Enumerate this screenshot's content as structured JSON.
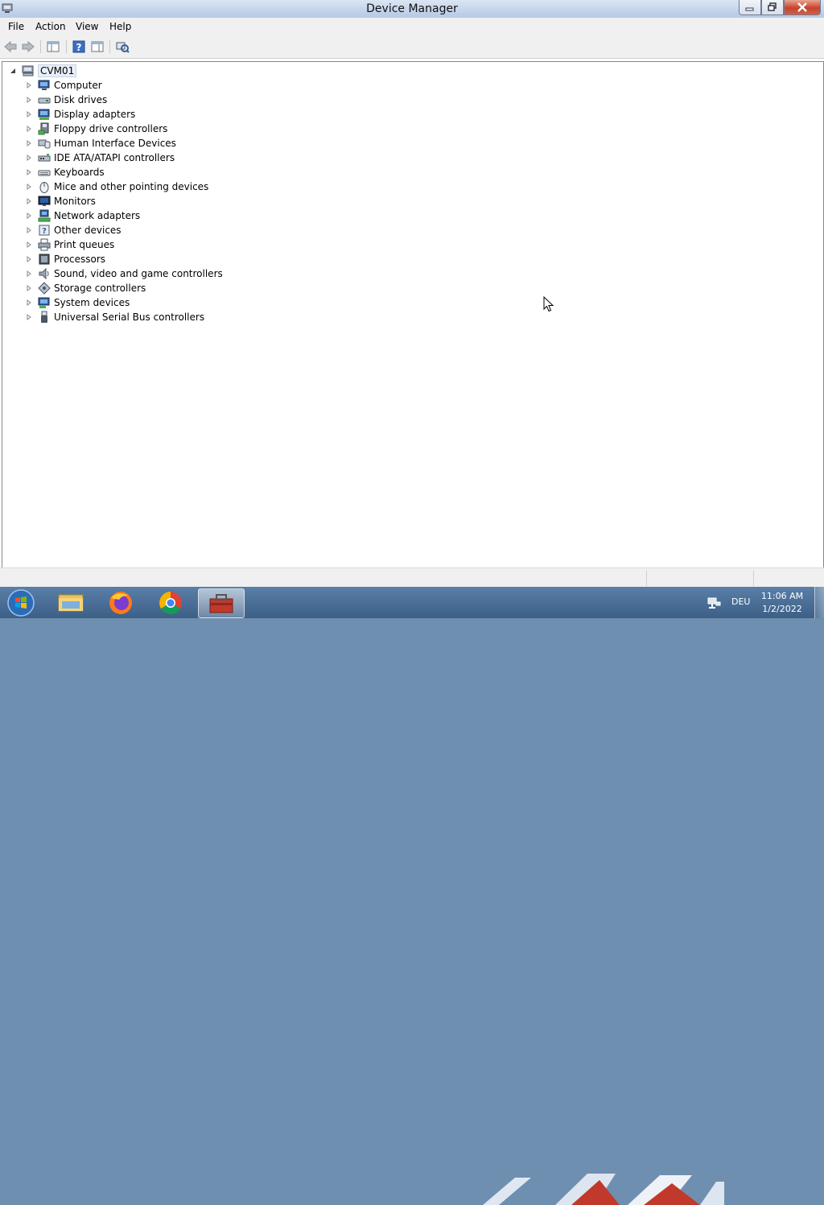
{
  "window": {
    "title": "Device Manager"
  },
  "menubar": {
    "items": [
      "File",
      "Action",
      "View",
      "Help"
    ]
  },
  "tree": {
    "root": "CVM01",
    "items": [
      {
        "label": "Computer",
        "icon": "computer-icon"
      },
      {
        "label": "Disk drives",
        "icon": "disk-drive-icon"
      },
      {
        "label": "Display adapters",
        "icon": "display-adapter-icon"
      },
      {
        "label": "Floppy drive controllers",
        "icon": "floppy-controller-icon"
      },
      {
        "label": "Human Interface Devices",
        "icon": "hid-icon"
      },
      {
        "label": "IDE ATA/ATAPI controllers",
        "icon": "ide-controller-icon"
      },
      {
        "label": "Keyboards",
        "icon": "keyboard-icon"
      },
      {
        "label": "Mice and other pointing devices",
        "icon": "mouse-icon"
      },
      {
        "label": "Monitors",
        "icon": "monitor-icon"
      },
      {
        "label": "Network adapters",
        "icon": "network-adapter-icon"
      },
      {
        "label": "Other devices",
        "icon": "other-devices-icon"
      },
      {
        "label": "Print queues",
        "icon": "printer-icon"
      },
      {
        "label": "Processors",
        "icon": "processor-icon"
      },
      {
        "label": "Sound, video and game controllers",
        "icon": "sound-icon"
      },
      {
        "label": "Storage controllers",
        "icon": "storage-controller-icon"
      },
      {
        "label": "System devices",
        "icon": "system-devices-icon"
      },
      {
        "label": "Universal Serial Bus controllers",
        "icon": "usb-icon"
      }
    ]
  },
  "taskbar": {
    "language": "DEU",
    "time": "11:06 AM",
    "date": "1/2/2022"
  }
}
